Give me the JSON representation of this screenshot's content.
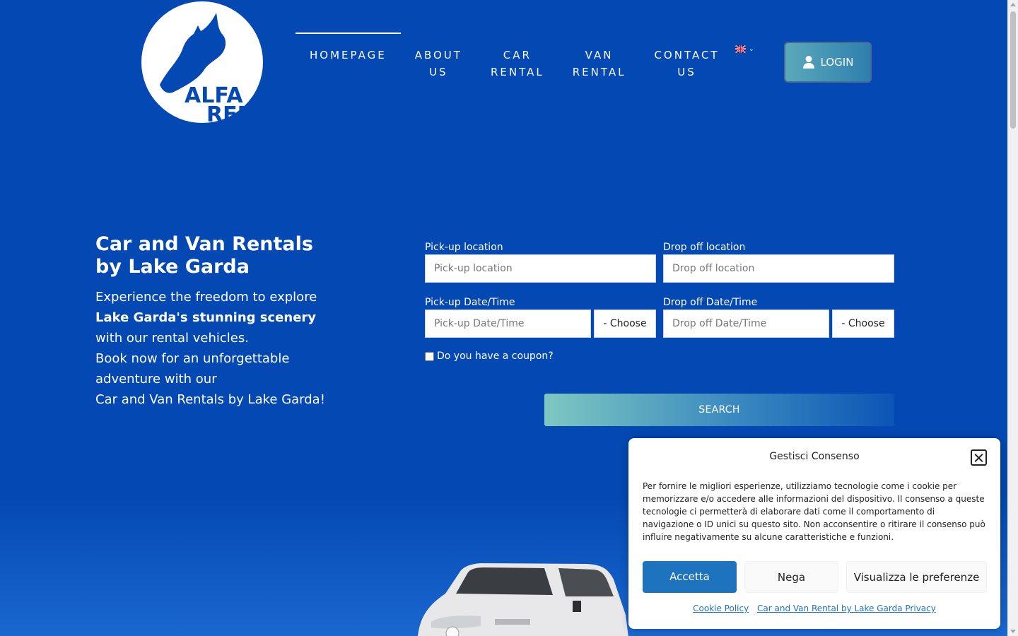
{
  "brand": {
    "logo_line1": "ALFA",
    "logo_line2": "RENT"
  },
  "nav": {
    "items": [
      {
        "line1": "HOMEPAGE",
        "line2": ""
      },
      {
        "line1": "ABOUT",
        "line2": "US"
      },
      {
        "line1": "CAR",
        "line2": "RENTAL"
      },
      {
        "line1": "VAN",
        "line2": "RENTAL"
      },
      {
        "line1": "CONTACT",
        "line2": "US"
      }
    ],
    "language_icon": "uk-flag-icon",
    "login_label": "LOGIN"
  },
  "hero": {
    "title": "Car and Van Rentals by Lake Garda",
    "body_1": "Experience the freedom to explore",
    "body_bold": "Lake Garda's stunning scenery",
    "body_2": " with our rental vehicles.",
    "body_3": "Book now for an unforgettable adventure with our",
    "body_4": "Car and Van Rentals by Lake Garda!"
  },
  "form": {
    "pickup_location_label": "Pick-up location",
    "pickup_location_placeholder": "Pick-up location",
    "dropoff_location_label": "Drop off location",
    "dropoff_location_placeholder": "Drop off location",
    "pickup_datetime_label": "Pick-up Date/Time",
    "pickup_datetime_placeholder": "Pick-up Date/Time",
    "dropoff_datetime_label": "Drop off Date/Time",
    "dropoff_datetime_placeholder": "Drop off Date/Time",
    "choose_label": "- Choose",
    "coupon_label": "Do you have a coupon?",
    "search_label": "SEARCH"
  },
  "cookie": {
    "title": "Gestisci Consenso",
    "text": "Per fornire le migliori esperienze, utilizziamo tecnologie come i cookie per memorizzare e/o accedere alle informazioni del dispositivo. Il consenso a queste tecnologie ci permetterà di elaborare dati come il comportamento di navigazione o ID unici su questo sito. Non acconsentire o ritirare il consenso può influire negativamente su alcune caratteristiche e funzioni.",
    "accept": "Accetta",
    "deny": "Nega",
    "preferences": "Visualizza le preferenze",
    "link_cookie_policy": "Cookie Policy",
    "link_privacy": "Car and Van Rental by Lake Garda Privacy"
  },
  "colors": {
    "background": "#0448b3",
    "accept_button": "#1e73be"
  }
}
